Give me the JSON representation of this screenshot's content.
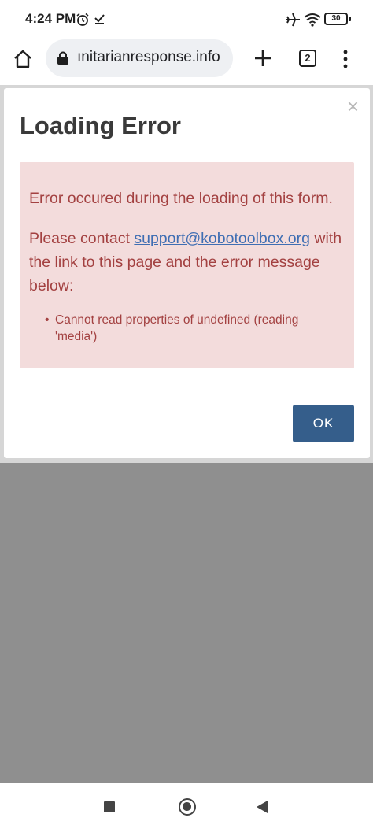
{
  "status_bar": {
    "time": "4:24 PM",
    "battery": "30",
    "icons": [
      "alarm-icon",
      "check-icon",
      "airplane-icon",
      "wifi-icon",
      "battery-icon"
    ]
  },
  "browser": {
    "url": "ınitarianresponse.info",
    "tab_count": "2",
    "icons": [
      "home-icon",
      "lock-icon",
      "new-tab-icon",
      "tab-switcher-icon",
      "more-menu-icon"
    ]
  },
  "dialog": {
    "title": "Loading Error",
    "close_glyph": "×",
    "message_line1": "Error occured during the loading of this form.",
    "message_line2_before": "Please contact ",
    "support_link": "support@kobotoolbox.org",
    "message_line2_after": " with the link to this page and the error message below:",
    "error_items": [
      "Cannot read properties of undefined (reading 'media')"
    ],
    "ok_label": "OK"
  },
  "nav_bar": {
    "icons": [
      "recents-icon",
      "home-circle-icon",
      "back-icon"
    ]
  },
  "colors": {
    "alert_bg": "#f3dcdc",
    "alert_text": "#a34141",
    "link": "#3f6eb3",
    "ok_button": "#355e8b",
    "overlay": "#8f8f8f"
  }
}
